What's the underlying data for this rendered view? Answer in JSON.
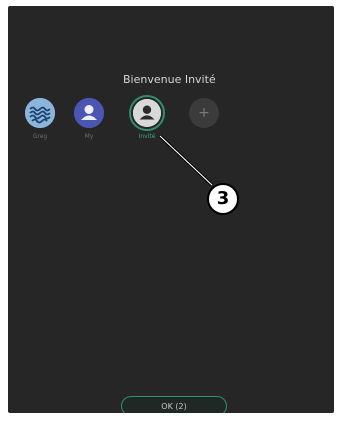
{
  "header": {
    "title": "Bienvenue Invité"
  },
  "profiles": [
    {
      "label": "Greg",
      "icon": "waves-avatar-icon",
      "active": false
    },
    {
      "label": "My",
      "icon": "user-icon",
      "active": false
    },
    {
      "label": "Invité",
      "icon": "user-icon",
      "active": true
    },
    {
      "label": "",
      "icon": "plus-icon",
      "active": false
    }
  ],
  "add_profile": {
    "symbol": "+"
  },
  "callout": {
    "number": "3"
  },
  "footer": {
    "ok_label": "OK (2)"
  },
  "colors": {
    "background": "#262626",
    "accent": "#2f8f6f",
    "greg_avatar": "#8ab6dc",
    "my_avatar": "#4b56b3",
    "invite_avatar": "#d9d9d9"
  }
}
